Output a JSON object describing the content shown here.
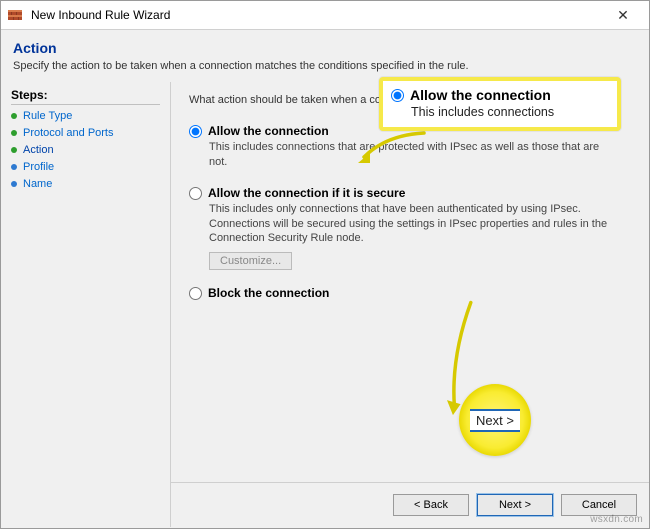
{
  "window": {
    "title": "New Inbound Rule Wizard"
  },
  "header": {
    "heading": "Action",
    "subtitle": "Specify the action to be taken when a connection matches the conditions specified in the rule."
  },
  "sidebar": {
    "title": "Steps:",
    "items": [
      {
        "label": "Rule Type"
      },
      {
        "label": "Protocol and Ports"
      },
      {
        "label": "Action"
      },
      {
        "label": "Profile"
      },
      {
        "label": "Name"
      }
    ]
  },
  "main": {
    "prompt": "What action should be taken when a connection matches the specified conditions?",
    "options": [
      {
        "label": "Allow the connection",
        "desc": "This includes connections that are protected with IPsec as well as those that are not."
      },
      {
        "label": "Allow the connection if it is secure",
        "desc": "This includes only connections that have been authenticated by using IPsec. Connections will be secured using the settings in IPsec properties and rules in the Connection Security Rule node."
      },
      {
        "label": "Block the connection"
      }
    ],
    "customize_label": "Customize..."
  },
  "callout": {
    "label": "Allow the connection",
    "desc": "This includes connections"
  },
  "next_highlight": {
    "label": "Next >"
  },
  "footer": {
    "back": "< Back",
    "next": "Next >",
    "cancel": "Cancel"
  },
  "watermark": "wsxdn.com"
}
